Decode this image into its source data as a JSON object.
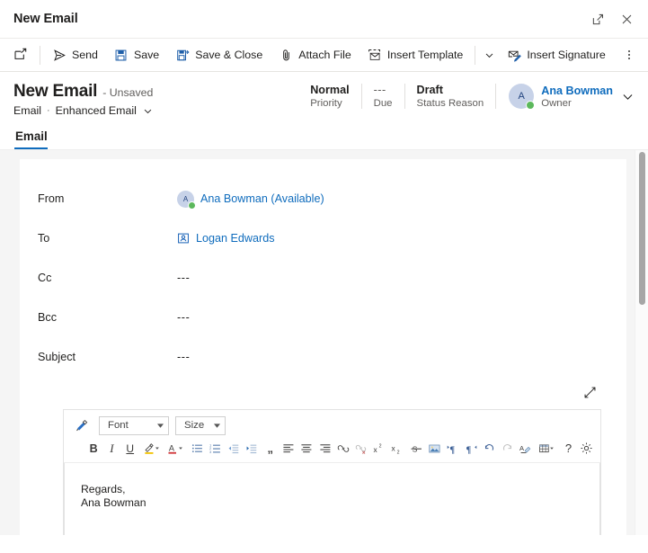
{
  "window": {
    "title": "New Email",
    "popout_icon": "popout-icon",
    "close_icon": "close-icon"
  },
  "commandbar": {
    "new_icon": "new-window-icon",
    "buttons": [
      {
        "label": "Send",
        "icon": "send-icon"
      },
      {
        "label": "Save",
        "icon": "save-icon"
      },
      {
        "label": "Save & Close",
        "icon": "save-and-close-icon"
      },
      {
        "label": "Attach File",
        "icon": "paperclip-icon"
      },
      {
        "label": "Insert Template",
        "icon": "insert-template-icon"
      },
      {
        "label": "Insert Signature",
        "icon": "insert-signature-icon"
      }
    ],
    "dropdown_caret": "chevron-down-icon",
    "overflow": "more-commands-icon"
  },
  "record_header": {
    "title": "New Email",
    "unsaved": "- Unsaved",
    "entity": "Email",
    "separator": "·",
    "form_name": "Enhanced Email",
    "stats": [
      {
        "value": "Normal",
        "label": "Priority",
        "dim": false
      },
      {
        "value": "---",
        "label": "Due",
        "dim": true
      },
      {
        "value": "Draft",
        "label": "Status Reason",
        "dim": false
      }
    ],
    "owner": {
      "initial": "A",
      "name": "Ana Bowman",
      "role": "Owner",
      "presence": "available"
    }
  },
  "tabs": [
    {
      "label": "Email",
      "selected": true
    }
  ],
  "form": {
    "fields": [
      {
        "label": "From",
        "type": "person",
        "initial": "A",
        "value": "Ana Bowman (Available)",
        "presence": "available"
      },
      {
        "label": "To",
        "type": "contact",
        "icon": "contact-card-icon",
        "value": "Logan Edwards"
      },
      {
        "label": "Cc",
        "type": "empty",
        "value": "---"
      },
      {
        "label": "Bcc",
        "type": "empty",
        "value": "---"
      },
      {
        "label": "Subject",
        "type": "empty",
        "value": "---"
      }
    ]
  },
  "editor": {
    "expand_icon": "expand-diagonal-icon",
    "font_select": {
      "value": "Font",
      "caret": "chevron-down-icon"
    },
    "size_select": {
      "value": "Size",
      "caret": "chevron-down-icon"
    },
    "format_painter": "format-painter-icon",
    "tools_row2": [
      "bold-icon",
      "italic-icon",
      "underline-icon",
      "highlight-color-icon",
      "font-color-icon",
      "bulleted-list-icon",
      "numbered-list-icon",
      "decrease-indent-icon",
      "increase-indent-icon",
      "blockquote-icon",
      "align-left-icon",
      "align-center-icon",
      "align-right-icon",
      "insert-link-icon",
      "remove-link-icon",
      "superscript-icon",
      "subscript-icon",
      "strikethrough-icon",
      "insert-image-icon",
      "ltr-icon",
      "rtl-icon",
      "undo-icon",
      "redo-icon",
      "clear-formatting-icon",
      "insert-table-icon",
      "help-icon",
      "settings-gear-icon"
    ],
    "body_lines": [
      "Regards,",
      "Ana Bowman"
    ]
  },
  "colors": {
    "accent": "#0f6cbd",
    "link": "#0f6cbd",
    "text": "#201f1e",
    "muted": "#605e5c",
    "presence_green": "#5cb85c",
    "canvas": "#f5f5f5"
  }
}
